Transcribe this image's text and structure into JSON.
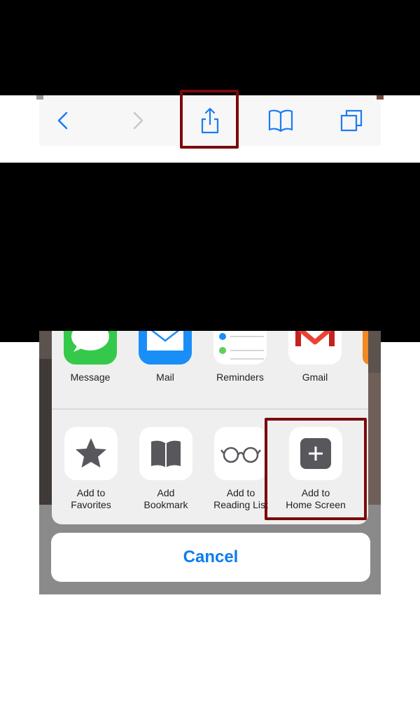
{
  "toolbar": {
    "buttons": [
      {
        "name": "back",
        "icon": "chevron-left-icon"
      },
      {
        "name": "forward",
        "icon": "chevron-right-icon"
      },
      {
        "name": "share",
        "icon": "share-icon"
      },
      {
        "name": "bookmarks",
        "icon": "book-icon"
      },
      {
        "name": "tabs",
        "icon": "tabs-icon"
      }
    ],
    "accent_color": "#1a7cf5",
    "disabled_color": "#c7c7cc"
  },
  "share_sheet": {
    "apps": [
      {
        "label": "Message",
        "icon": "message-icon"
      },
      {
        "label": "Mail",
        "icon": "mail-icon"
      },
      {
        "label": "Reminders",
        "icon": "reminders-icon"
      },
      {
        "label": "Gmail",
        "icon": "gmail-icon"
      }
    ],
    "actions": [
      {
        "label": "Add to\nFavorites",
        "icon": "star-icon"
      },
      {
        "label": "Add\nBookmark",
        "icon": "book-icon"
      },
      {
        "label": "Add to\nReading List",
        "icon": "glasses-icon"
      },
      {
        "label": "Add to\nHome Screen",
        "icon": "plus-square-icon"
      }
    ],
    "cancel_label": "Cancel"
  },
  "highlight_color": "#7b0a0a"
}
